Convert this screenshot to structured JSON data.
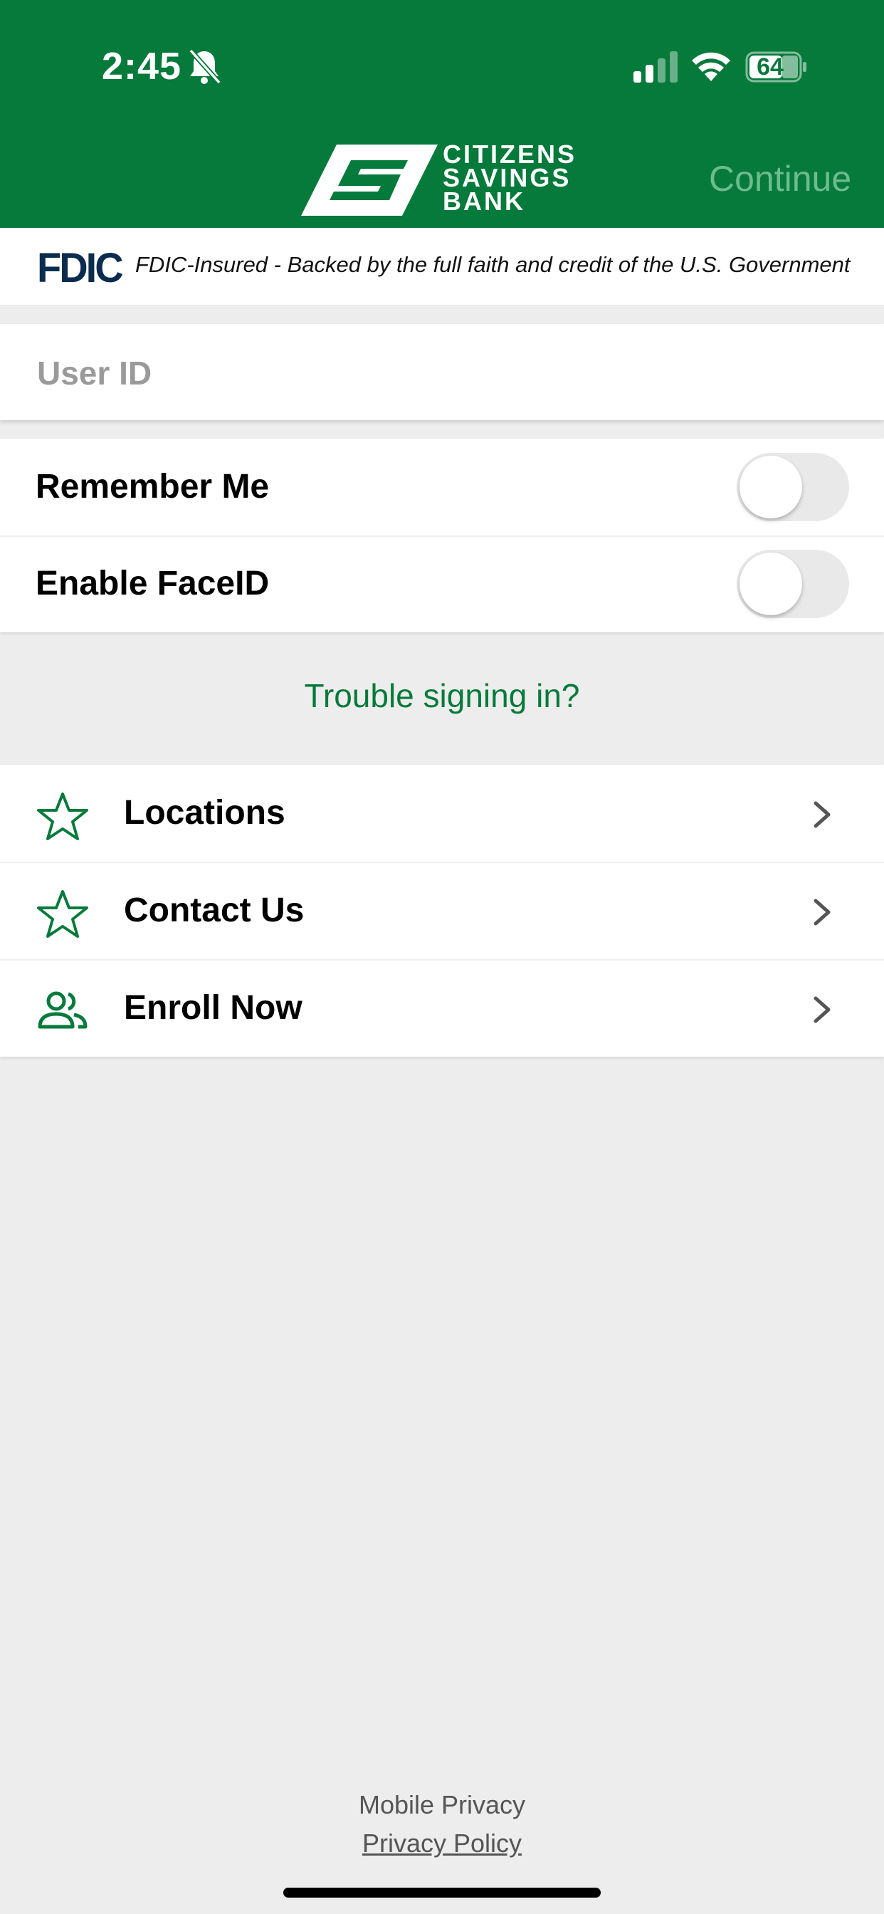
{
  "status_bar": {
    "time": "2:45",
    "battery_level": "64",
    "icons": [
      "bell-slash-icon",
      "cellular-signal-icon",
      "wifi-icon",
      "battery-icon"
    ]
  },
  "header": {
    "logo_lines": [
      "CITIZENS",
      "SAVINGS",
      "BANK"
    ],
    "continue_label": "Continue",
    "background_color": "#067a3b",
    "continue_color": "#6dbd8c"
  },
  "fdic": {
    "logo": "FDIC",
    "notice": "FDIC-Insured - Backed by the full faith and credit of the U.S. Government"
  },
  "login": {
    "user_id_placeholder": "User ID",
    "user_id_value": ""
  },
  "toggles": [
    {
      "label": "Remember Me",
      "enabled": false
    },
    {
      "label": "Enable FaceID",
      "enabled": false
    }
  ],
  "trouble_link": "Trouble signing in?",
  "menu": [
    {
      "label": "Locations",
      "icon": "star-outline-icon"
    },
    {
      "label": "Contact Us",
      "icon": "star-outline-icon"
    },
    {
      "label": "Enroll Now",
      "icon": "people-icon"
    }
  ],
  "footer": {
    "mobile_privacy": "Mobile Privacy",
    "privacy_policy": "Privacy Policy"
  },
  "accent_color": "#067a3b"
}
